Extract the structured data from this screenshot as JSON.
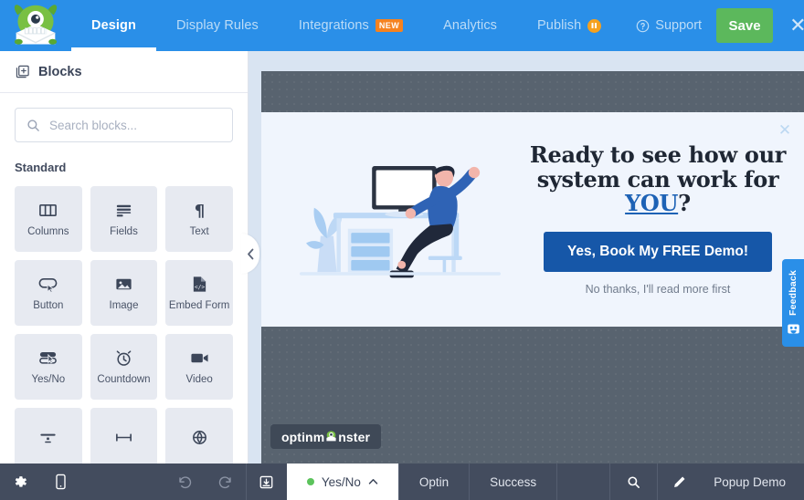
{
  "header": {
    "logo_icon": "optinmonster-monster-logo",
    "tabs": [
      {
        "label": "Design",
        "active": true,
        "badge": null
      },
      {
        "label": "Display Rules",
        "active": false,
        "badge": null
      },
      {
        "label": "Integrations",
        "active": false,
        "badge": "NEW"
      },
      {
        "label": "Analytics",
        "active": false,
        "badge": null
      },
      {
        "label": "Publish",
        "active": false,
        "badge": "pause"
      }
    ],
    "support_label": "Support",
    "support_icon": "question-circle-icon",
    "save_label": "Save",
    "close_icon": "close-icon",
    "bg_color": "#2a8fe8",
    "save_color": "#5cb85c",
    "badge_new_color": "#f5821f",
    "badge_pause_color": "#f5a11f"
  },
  "sidebar": {
    "title": "Blocks",
    "title_icon": "add-block-icon",
    "search": {
      "placeholder": "Search blocks...",
      "value": "",
      "icon": "search-icon"
    },
    "section_label": "Standard",
    "blocks": [
      {
        "label": "Columns",
        "icon": "columns-icon"
      },
      {
        "label": "Fields",
        "icon": "fields-icon"
      },
      {
        "label": "Text",
        "icon": "paragraph-icon"
      },
      {
        "label": "Button",
        "icon": "button-icon"
      },
      {
        "label": "Image",
        "icon": "image-icon"
      },
      {
        "label": "Embed Form",
        "icon": "embed-form-icon"
      },
      {
        "label": "Yes/No",
        "icon": "yes-no-icon"
      },
      {
        "label": "Countdown",
        "icon": "alarm-clock-icon"
      },
      {
        "label": "Video",
        "icon": "video-camera-icon"
      },
      {
        "label": "",
        "icon": "divider-icon"
      },
      {
        "label": "",
        "icon": "spacer-icon"
      },
      {
        "label": "",
        "icon": "social-icon"
      }
    ],
    "collapse_icon": "chevron-left-icon"
  },
  "canvas": {
    "popup": {
      "close_icon": "close-icon",
      "illustration": "person-at-desk-illustration",
      "headline_part1": "Ready to see how our system can work for ",
      "headline_highlight": "YOU",
      "headline_part2": "?",
      "cta_label": "Yes, Book My FREE Demo!",
      "decline_label": "No thanks, I'll read more first",
      "cta_color": "#1657a8",
      "bg_color": "#f0f5fd",
      "watermark": "optinmonster"
    },
    "overlay_color": "#58636f",
    "feedback_label": "Feedback",
    "feedback_icon": "monster-face-icon"
  },
  "bottombar": {
    "settings_icon": "gear-icon",
    "mobile_icon": "mobile-device-icon",
    "undo_icon": "undo-icon",
    "redo_icon": "redo-icon",
    "export_icon": "save-template-icon",
    "tabs": [
      {
        "label": "Yes/No",
        "active": true,
        "status": "green"
      },
      {
        "label": "Optin",
        "active": false,
        "status": null
      },
      {
        "label": "Success",
        "active": false,
        "status": null
      }
    ],
    "chevron_icon": "chevron-up-icon",
    "preview_icon": "search-icon",
    "edit_icon": "pencil-icon",
    "campaign_name": "Popup Demo",
    "bg_color": "#434c5e"
  }
}
